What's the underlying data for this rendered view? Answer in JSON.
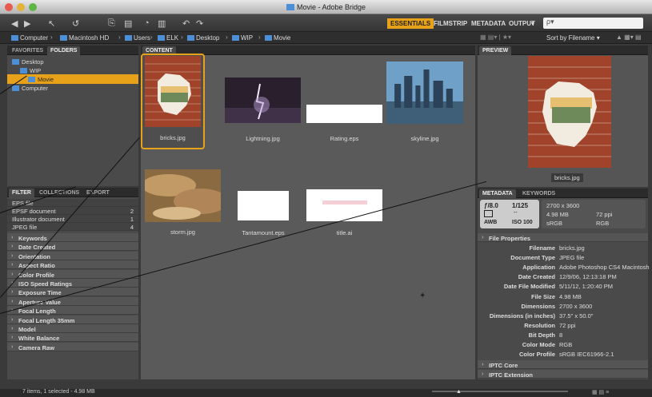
{
  "window": {
    "title": "Movie - Adobe Bridge"
  },
  "toolbar": {
    "workspaces": [
      "ESSENTIALS",
      "FILMSTRIP",
      "METADATA",
      "OUTPUT"
    ],
    "search_placeholder": "ρ▾"
  },
  "path": {
    "crumbs": [
      "Computer",
      "Macintosh HD",
      "Users",
      "ELK",
      "Desktop",
      "WIP",
      "Movie"
    ],
    "sort_label": "Sort by Filename ▾"
  },
  "left": {
    "tabs": [
      "FAVORITES",
      "FOLDERS"
    ],
    "tree": [
      {
        "label": "Desktop",
        "indent": 0,
        "selected": false
      },
      {
        "label": "WIP",
        "indent": 1,
        "selected": false
      },
      {
        "label": "Movie",
        "indent": 2,
        "selected": true
      },
      {
        "label": "Computer",
        "indent": 0,
        "selected": false
      }
    ]
  },
  "filter": {
    "tabs": [
      "FILTER",
      "COLLECTIONS",
      "EXPORT"
    ],
    "file_types": [
      {
        "label": "EPS file",
        "count": ""
      },
      {
        "label": "EPSF document",
        "count": "2"
      },
      {
        "label": "Illustrator document",
        "count": "1"
      },
      {
        "label": "JPEG file",
        "count": "4"
      }
    ],
    "categories": [
      "Keywords",
      "Date Created",
      "Orientation",
      "Aspect Ratio",
      "Color Profile",
      "ISO Speed Ratings",
      "Exposure Time",
      "Aperture Value",
      "Focal Length",
      "Focal Length 35mm",
      "Model",
      "White Balance",
      "Camera Raw"
    ]
  },
  "content": {
    "tab": "CONTENT",
    "items": [
      {
        "name": "bricks.jpg",
        "kind": "bricks",
        "selected": true
      },
      {
        "name": "Lightning.jpg",
        "kind": "lightning",
        "selected": false
      },
      {
        "name": "Rating.eps",
        "kind": "white",
        "selected": false
      },
      {
        "name": "skyline.jpg",
        "kind": "skyline",
        "selected": false
      },
      {
        "name": "storm.jpg",
        "kind": "storm",
        "selected": false
      },
      {
        "name": "Tantamount.eps",
        "kind": "white",
        "selected": false
      },
      {
        "name": "title.ai",
        "kind": "title",
        "selected": false
      }
    ]
  },
  "preview": {
    "tab": "PREVIEW",
    "caption": "bricks.jpg"
  },
  "metadata": {
    "tabs": [
      "METADATA",
      "KEYWORDS"
    ],
    "camera": {
      "aperture": "ƒ/8.0",
      "shutter": "1/125",
      "iso": "ISO 100",
      "awb": "AWB",
      "dims": "2700 x 3600",
      "size": "4.98 MB",
      "ppi": "72 ppi",
      "colorspace": "sRGB",
      "mode": "RGB"
    },
    "section": "File Properties",
    "fields": [
      [
        "Filename",
        "bricks.jpg"
      ],
      [
        "Document Type",
        "JPEG file"
      ],
      [
        "Application",
        "Adobe Photoshop CS4 Macintosh"
      ],
      [
        "Date Created",
        "12/9/06, 12:13:18 PM"
      ],
      [
        "Date File Modified",
        "5/11/12, 1:20:40 PM"
      ],
      [
        "File Size",
        "4.98 MB"
      ],
      [
        "Dimensions",
        "2700 x 3600"
      ],
      [
        "Dimensions (in inches)",
        "37.5\" x 50.0\""
      ],
      [
        "Resolution",
        "72 ppi"
      ],
      [
        "Bit Depth",
        "8"
      ],
      [
        "Color Mode",
        "RGB"
      ],
      [
        "Color Profile",
        "sRGB IEC61966-2.1"
      ]
    ],
    "more_sections": [
      "IPTC Core",
      "IPTC Extension"
    ]
  },
  "status": {
    "text": "7 items, 1 selected - 4.98 MB"
  }
}
